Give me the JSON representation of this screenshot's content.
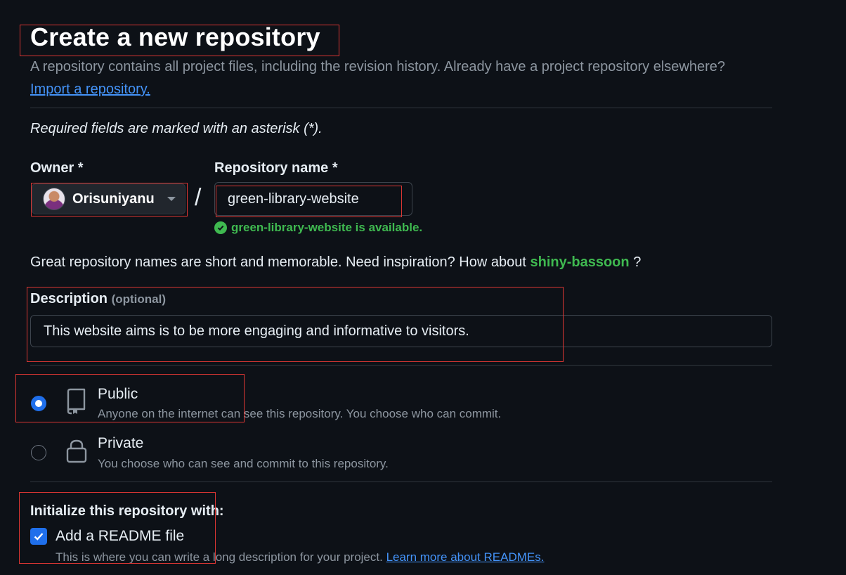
{
  "header": {
    "title": "Create a new repository",
    "subtitle": "A repository contains all project files, including the revision history. Already have a project repository elsewhere?",
    "import_link": "Import a repository."
  },
  "form": {
    "required_note": "Required fields are marked with an asterisk (*).",
    "owner": {
      "label": "Owner *",
      "value": "Orisuniyanu"
    },
    "separator": "/",
    "repo_name": {
      "label": "Repository name *",
      "value": "green-library-website",
      "availability": "green-library-website is available."
    },
    "suggestion": {
      "prefix": "Great repository names are short and memorable. Need inspiration? How about",
      "name": "shiny-bassoon",
      "suffix": "?"
    },
    "description": {
      "label": "Description",
      "optional": "(optional)",
      "value": "This website aims is to be more engaging and informative to visitors."
    },
    "visibility": {
      "selected": "Public",
      "options": [
        {
          "title": "Public",
          "desc": "Anyone on the internet can see this repository. You choose who can commit."
        },
        {
          "title": "Private",
          "desc": "You choose who can see and commit to this repository."
        }
      ]
    },
    "initialize": {
      "heading": "Initialize this repository with:",
      "readme": {
        "label": "Add a README file",
        "checked": true,
        "desc": "This is where you can write a long description for your project.",
        "link": "Learn more about READMEs."
      }
    }
  },
  "colors": {
    "background": "#0d1117",
    "accent": "#1f6feb",
    "link": "#4493f8",
    "success": "#3fb950",
    "highlight_box": "#da3633"
  }
}
